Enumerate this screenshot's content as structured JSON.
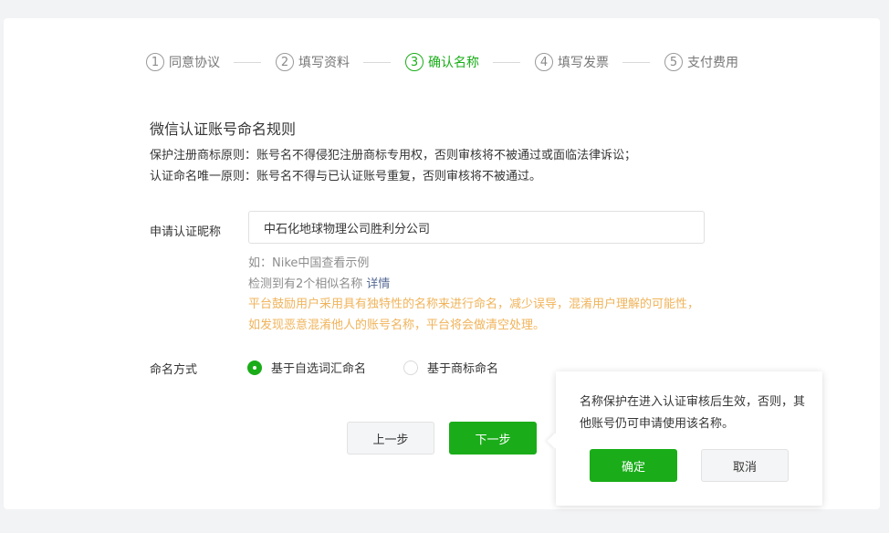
{
  "steps": [
    {
      "num": "1",
      "label": "同意协议",
      "active": false
    },
    {
      "num": "2",
      "label": "填写资料",
      "active": false
    },
    {
      "num": "3",
      "label": "确认名称",
      "active": true
    },
    {
      "num": "4",
      "label": "填写发票",
      "active": false
    },
    {
      "num": "5",
      "label": "支付费用",
      "active": false
    }
  ],
  "rules": {
    "title": "微信认证账号命名规则",
    "lines": [
      "保护注册商标原则：账号名不得侵犯注册商标专用权，否则审核将不被通过或面临法律诉讼；",
      "认证命名唯一原则：账号名不得与已认证账号重复，否则审核将不被通过。"
    ]
  },
  "form": {
    "name_label": "申请认证昵称",
    "name_value": "中石化地球物理公司胜利分公司",
    "example_hint": "如：Nike中国查看示例",
    "similar_hint": "检测到有2个相似名称",
    "similar_link": "详情",
    "warning_lines": [
      "平台鼓励用户采用具有独特性的名称来进行命名，减少误导，混淆用户理解的可能性，",
      "如发现恶意混淆他人的账号名称，平台将会做清空处理。"
    ],
    "naming_label": "命名方式",
    "naming_options": [
      {
        "label": "基于自选词汇命名",
        "checked": true
      },
      {
        "label": "基于商标命名",
        "checked": false
      }
    ]
  },
  "actions": {
    "prev": "上一步",
    "next": "下一步"
  },
  "popover": {
    "text": "名称保护在进入认证审核后生效，否则，其他账号仍可申请使用该名称。",
    "confirm": "确定",
    "cancel": "取消"
  },
  "colors": {
    "accent": "#1aad19",
    "warning": "#f0b35a",
    "link": "#576b95"
  }
}
